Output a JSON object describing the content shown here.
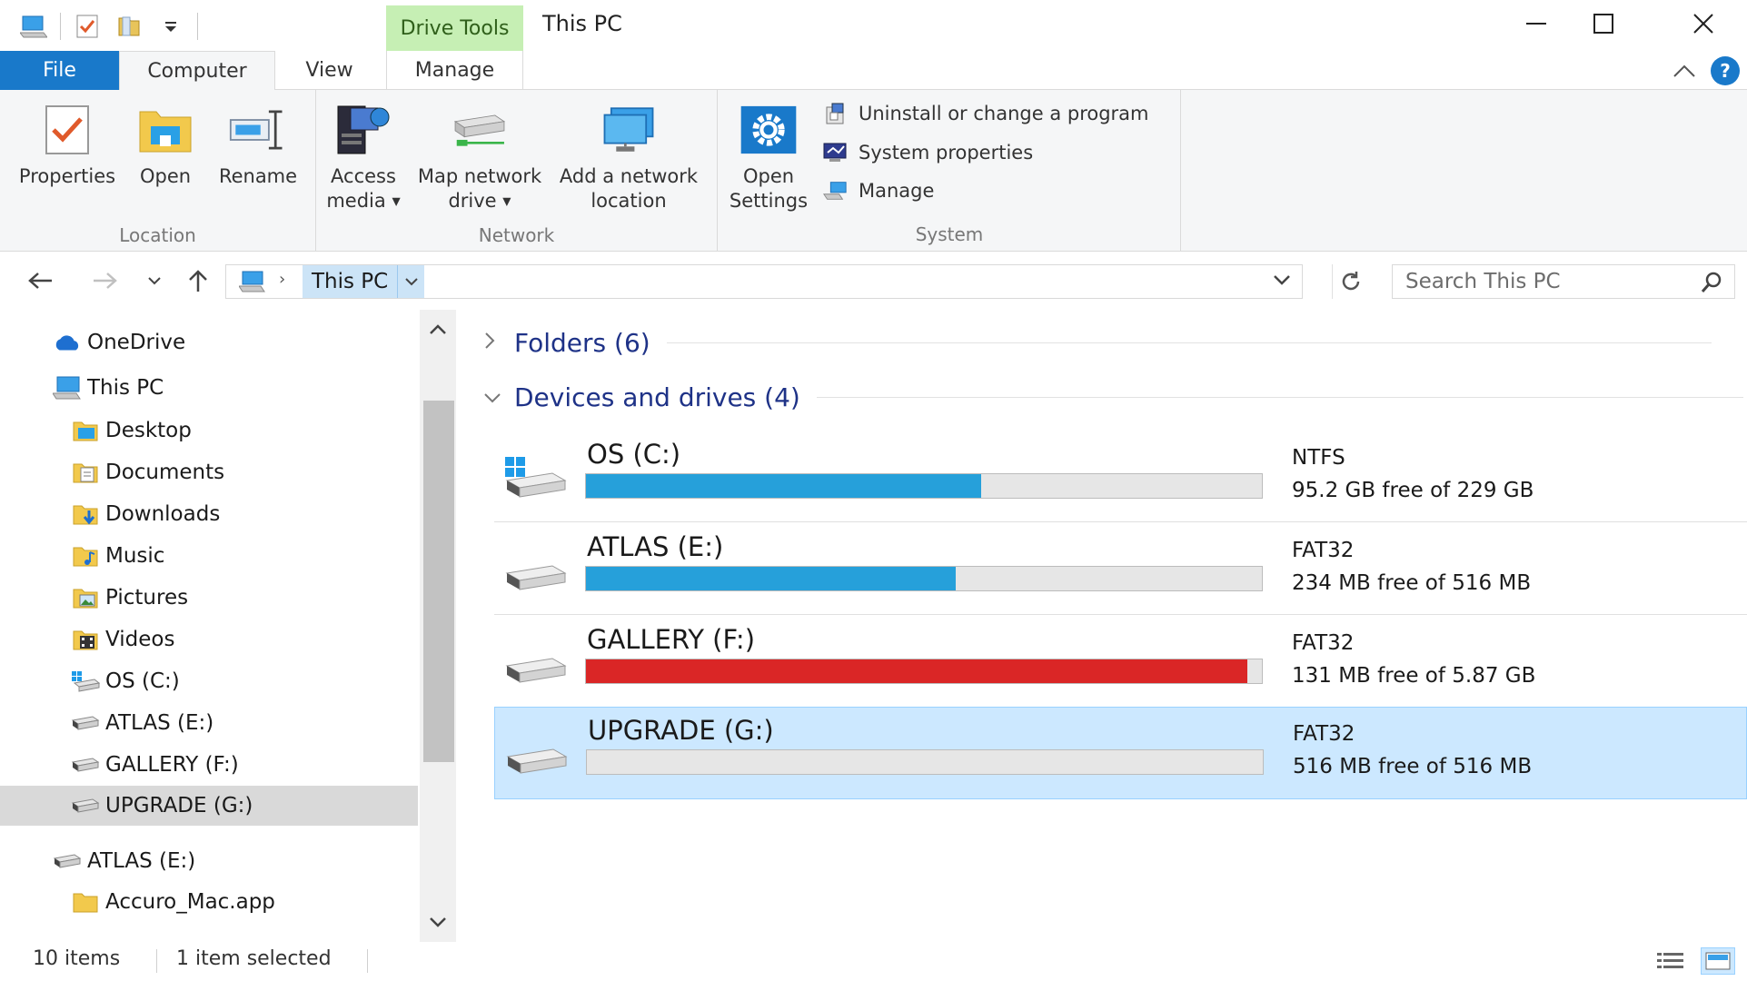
{
  "window": {
    "title": "This PC",
    "contextual_tab_label": "Drive Tools"
  },
  "tabs": {
    "file": "File",
    "computer": "Computer",
    "view": "View",
    "manage": "Manage"
  },
  "ribbon": {
    "location": {
      "label": "Location",
      "properties": "Properties",
      "open": "Open",
      "rename": "Rename"
    },
    "network": {
      "label": "Network",
      "access_media_1": "Access",
      "access_media_2": "media",
      "map_drive_1": "Map network",
      "map_drive_2": "drive",
      "add_location_1": "Add a network",
      "add_location_2": "location"
    },
    "system": {
      "label": "System",
      "open_settings_1": "Open",
      "open_settings_2": "Settings",
      "uninstall": "Uninstall or change a program",
      "system_properties": "System properties",
      "manage": "Manage"
    }
  },
  "address": {
    "crumb": "This PC",
    "search_placeholder": "Search This PC"
  },
  "nav_tree": [
    {
      "label": "OneDrive",
      "icon": "cloud-icon"
    },
    {
      "label": "This PC",
      "icon": "computer-icon"
    },
    {
      "label": "Desktop",
      "icon": "desktop-folder-icon"
    },
    {
      "label": "Documents",
      "icon": "documents-folder-icon"
    },
    {
      "label": "Downloads",
      "icon": "downloads-folder-icon"
    },
    {
      "label": "Music",
      "icon": "music-folder-icon"
    },
    {
      "label": "Pictures",
      "icon": "pictures-folder-icon"
    },
    {
      "label": "Videos",
      "icon": "videos-folder-icon"
    },
    {
      "label": "OS (C:)",
      "icon": "windows-drive-icon"
    },
    {
      "label": "ATLAS (E:)",
      "icon": "drive-icon"
    },
    {
      "label": "GALLERY (F:)",
      "icon": "drive-icon"
    },
    {
      "label": "UPGRADE (G:)",
      "icon": "drive-icon"
    },
    {
      "label": "ATLAS (E:)",
      "icon": "drive-icon"
    },
    {
      "label": "Accuro_Mac.app",
      "icon": "folder-icon"
    }
  ],
  "content": {
    "folders_header": "Folders (6)",
    "devices_header": "Devices and drives (4)",
    "drives": [
      {
        "name": "OS (C:)",
        "fs": "NTFS",
        "free": "95.2 GB free of 229 GB",
        "used_fraction": 0.5843,
        "bar_color": "#26a0da"
      },
      {
        "name": "ATLAS (E:)",
        "fs": "FAT32",
        "free": "234 MB free of 516 MB",
        "used_fraction": 0.5465,
        "bar_color": "#26a0da"
      },
      {
        "name": "GALLERY (F:)",
        "fs": "FAT32",
        "free": "131 MB free of 5.87 GB",
        "used_fraction": 0.978,
        "bar_color": "#da2626"
      },
      {
        "name": "UPGRADE (G:)",
        "fs": "FAT32",
        "free": "516 MB free of 516 MB",
        "used_fraction": 0.0,
        "bar_color": "#26a0da"
      }
    ]
  },
  "status": {
    "items": "10 items",
    "selected": "1 item selected"
  },
  "colors": {
    "accent": "#1979ca",
    "selection": "#cce8ff",
    "drive_tools": "#c6efb4"
  }
}
